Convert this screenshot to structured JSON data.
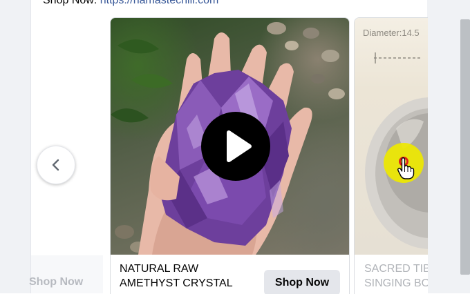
{
  "post": {
    "link_prefix": "Shop Now: ",
    "link_text": "https://namastechill.com"
  },
  "carousel": {
    "prev_arrow_icon": "chevron-left-icon",
    "prev_card": {
      "cta_label": "Shop Now"
    },
    "cards": [
      {
        "title_line1": "NATURAL RAW",
        "title_line2": "AMETHYST CRYSTAL",
        "cta_label": "Shop Now",
        "media_type": "video",
        "play_icon": "play-icon"
      },
      {
        "image_caption": "Diameter:14.5",
        "title_line1": "SACRED TIB",
        "title_line2": "SINGING BO"
      }
    ]
  },
  "colors": {
    "link": "#385898",
    "button_bg": "#e4e6eb",
    "cursor_highlight": "#eee800",
    "cursor_dot": "#e0201a"
  }
}
